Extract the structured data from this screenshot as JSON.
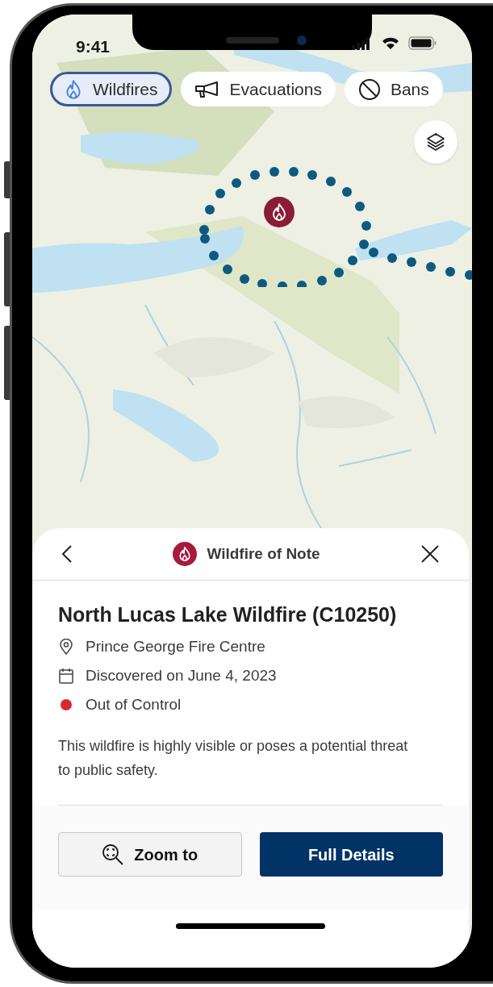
{
  "status_bar": {
    "time": "9:41"
  },
  "filters": [
    {
      "label": "Wildfires",
      "kind": "fire",
      "selected": true
    },
    {
      "label": "Evacuations",
      "kind": "megaphone",
      "selected": false
    },
    {
      "label": "Bans",
      "kind": "ban",
      "selected": false
    }
  ],
  "sheet": {
    "title": "Wildfire of Note",
    "name": "North Lucas Lake Wildfire (C10250)",
    "details": [
      {
        "kind": "location",
        "text": "Prince George Fire Centre"
      },
      {
        "kind": "date",
        "text": "Discovered on June 4, 2023"
      },
      {
        "kind": "status",
        "text": "Out of Control",
        "color": "#d8292f"
      }
    ],
    "description": "This wildfire is highly visible or poses a potential threat to public safety.",
    "buttons": [
      {
        "label": "Zoom to",
        "kind": "secondary"
      },
      {
        "label": "Full Details",
        "kind": "primary"
      }
    ]
  }
}
